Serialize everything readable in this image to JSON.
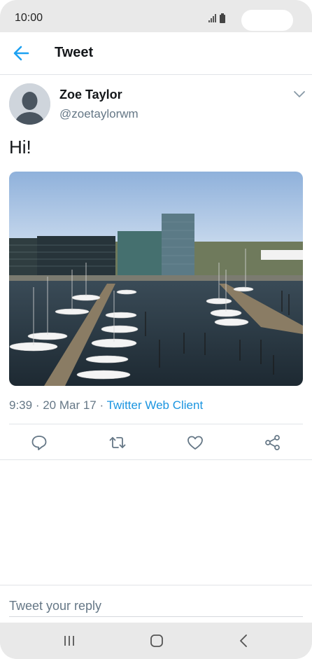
{
  "status_bar": {
    "time": "10:00",
    "signal_icon": "signal-icon",
    "battery_icon": "battery-icon"
  },
  "header": {
    "title": "Tweet",
    "back_icon": "back-arrow-icon",
    "accent_color": "#1da1f2"
  },
  "tweet": {
    "author_name": "Zoe Taylor",
    "author_handle": "@zoetaylorwm",
    "text": "Hi!",
    "photo_description_icon": "harbor-photo",
    "time": "9:39",
    "separator": " · ",
    "date": "20 Mar 17",
    "source": "Twitter Web Client",
    "link_color": "#1b95e0"
  },
  "actions": {
    "reply_icon": "reply-icon",
    "retweet_icon": "retweet-icon",
    "like_icon": "heart-icon",
    "share_icon": "share-icon"
  },
  "reply_box": {
    "placeholder": "Tweet your reply"
  },
  "nav_bar": {
    "recents_icon": "recents-icon",
    "home_icon": "home-icon",
    "back_icon": "nav-back-icon"
  }
}
